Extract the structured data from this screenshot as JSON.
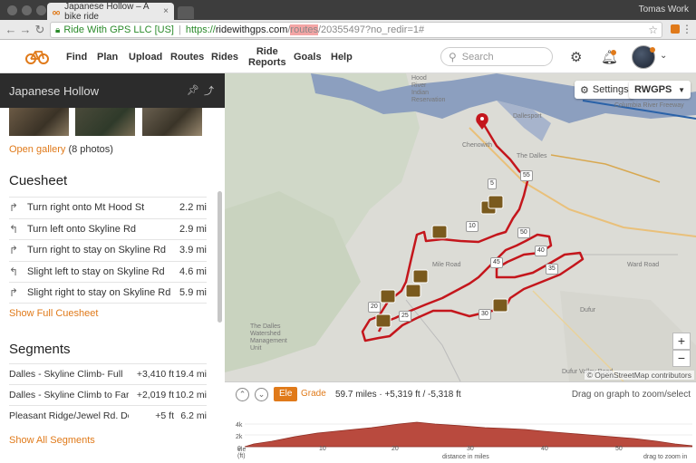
{
  "browser": {
    "tab_title": "Japanese Hollow – A bike ride",
    "profile": "Tomas Work",
    "secure_label": "Ride With GPS LLC [US]",
    "url_proto": "https://",
    "url_host": "ridewithgps.com",
    "url_sep": "/",
    "url_highlight": "routes",
    "url_rest": "/20355497?no_redir=1#"
  },
  "header": {
    "nav": [
      "Find",
      "Plan",
      "Upload",
      "Routes",
      "Rides",
      "Ride\nReports",
      "Goals",
      "Help"
    ],
    "search_placeholder": "Search"
  },
  "panel": {
    "title": "Japanese Hollow",
    "gallery_link": "Open gallery",
    "gallery_count": "(8 photos)",
    "cuesheet_title": "Cuesheet",
    "cues": [
      {
        "icon": "turn-right-icon",
        "glyph": "↱",
        "text": "Turn right onto Mt Hood St",
        "dist": "2.2 mi"
      },
      {
        "icon": "turn-left-icon",
        "glyph": "↰",
        "text": "Turn left onto Skyline Rd",
        "dist": "2.9 mi"
      },
      {
        "icon": "turn-right-icon",
        "glyph": "↱",
        "text": "Turn right to stay on Skyline Rd",
        "dist": "3.9 mi"
      },
      {
        "icon": "slight-left-icon",
        "glyph": "↰",
        "text": "Slight left to stay on Skyline Rd",
        "dist": "4.6 mi"
      },
      {
        "icon": "slight-right-icon",
        "glyph": "↱",
        "text": "Slight right to stay on Skyline Rd",
        "dist": "5.9 mi"
      }
    ],
    "show_cuesheet": "Show Full Cuesheet",
    "segments_title": "Segments",
    "segments": [
      {
        "name": "Dalles - Skyline Climb- Full",
        "elev": "+3,410 ft",
        "dist": "19.4 mi"
      },
      {
        "name": "Dalles - Skyline Climb to Far...",
        "elev": "+2,019 ft",
        "dist": "10.2 mi"
      },
      {
        "name": "Pleasant Ridge/Jewel Rd. Downhill",
        "elev": "+5 ft",
        "dist": "6.2 mi"
      }
    ],
    "show_segments": "Show All Segments"
  },
  "map": {
    "settings_label": "Settings",
    "layer_label": "RWGPS",
    "attribution": "© OpenStreetMap contributors",
    "zoom_in": "+",
    "zoom_out": "−",
    "labels": {
      "hood_river": "Hood\nRiver\nIndian\nReservation",
      "dallesport": "Dallesport",
      "chenowith": "Chenowith",
      "the_dalles": "The Dalles",
      "freeway": "Columbia River Freeway",
      "ward_road": "Ward Road",
      "watershed": "The Dalles\nWatershed\nManagement\nUnit",
      "dufur": "Dufur",
      "dufur_valley": "Dufur Valley Road",
      "mile_road": "Mile Road"
    },
    "markers": [
      "5",
      "10",
      "20",
      "25",
      "30",
      "35",
      "40",
      "45",
      "50",
      "55"
    ],
    "route_color": "#c4161c"
  },
  "elevation": {
    "tab_ele": "Ele",
    "tab_grade": "Grade",
    "stats": "59.7 miles · +5,319 ft / -5,318 ft",
    "hint": "Drag on graph to zoom/select",
    "y_ticks": [
      "4k",
      "2k",
      "0"
    ],
    "y_label": "ele\n(ft)",
    "x_ticks": [
      "10",
      "20",
      "30",
      "40",
      "50"
    ],
    "x_label": "distance in miles",
    "footer_hint": "drag to zoom in"
  },
  "colors": {
    "accent": "#e07a1a",
    "route": "#c4161c"
  }
}
